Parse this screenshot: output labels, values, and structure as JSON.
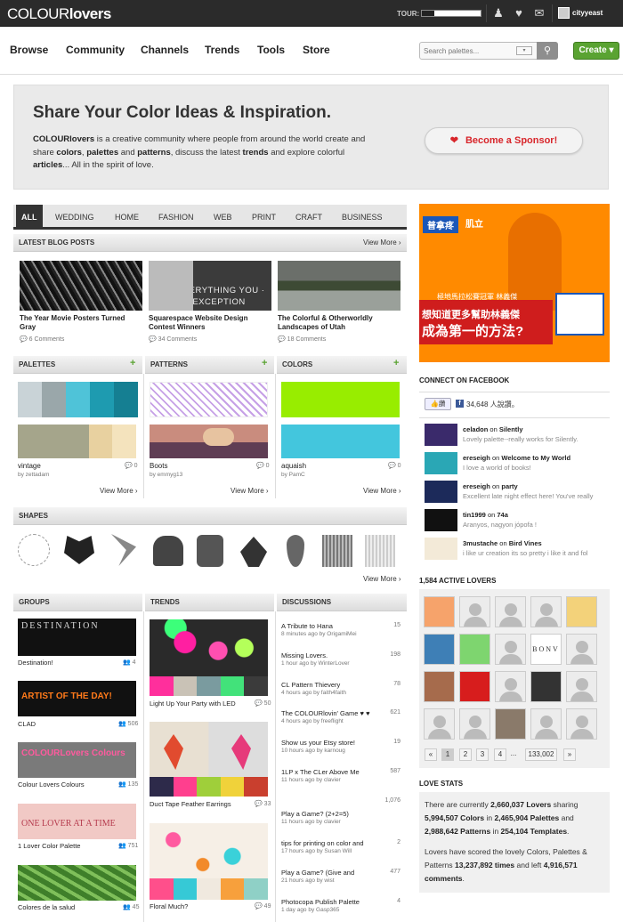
{
  "topbar": {
    "logo_light": "COLOUR",
    "logo_bold": "lovers",
    "tour_label": "TOUR:",
    "user_name": "cityyeast"
  },
  "nav": {
    "items": [
      "Browse",
      "Community",
      "Channels",
      "Trends",
      "Tools",
      "Store"
    ],
    "search_placeholder": "Search palettes...",
    "create_label": "Create ▾"
  },
  "hero": {
    "title": "Share Your Color Ideas & Inspiration.",
    "text_html_parts": [
      "COLOURlovers",
      " is a creative community where people from around the world create and share ",
      "colors",
      ", ",
      "palettes",
      " and ",
      "patterns",
      ", discuss the latest ",
      "trends",
      " and explore colorful ",
      "articles",
      "... All in the spirit of love."
    ],
    "sponsor": "Become a Sponsor!"
  },
  "tabs": [
    "ALL",
    "WEDDING",
    "HOME",
    "FASHION",
    "WEB",
    "PRINT",
    "CRAFT",
    "BUSINESS"
  ],
  "blog": {
    "heading": "LATEST BLOG POSTS",
    "view_more": "View More ›",
    "posts": [
      {
        "title": "The Year Movie Posters Turned Gray",
        "comments": "6 Comments"
      },
      {
        "title": "Squarespace Website Design Contest Winners",
        "comments": "34 Comments",
        "overlay": "EVERYTHING YOU · AN EXCEPTION"
      },
      {
        "title": "The Colorful & Otherworldly Landscapes of Utah",
        "comments": "18 Comments"
      }
    ]
  },
  "palettes": {
    "heading": "PALETTES",
    "view_more": "View More ›",
    "name": "vintage",
    "by": "by zettadam",
    "count": "0"
  },
  "patterns": {
    "heading": "PATTERNS",
    "view_more": "View More ›",
    "name": "Boots",
    "by": "by emmyg13",
    "count": "0"
  },
  "colors": {
    "heading": "COLORS",
    "view_more": "View More ›",
    "name": "aquaish",
    "by": "by PamC",
    "count": "0"
  },
  "shapes": {
    "heading": "SHAPES",
    "view_more": "View More ›"
  },
  "groups": {
    "heading": "GROUPS",
    "items": [
      {
        "name": "Destination!",
        "count": "4",
        "banner": "DESTINATION"
      },
      {
        "name": "CLAD",
        "count": "506",
        "banner": "ARTIST OF THE DAY!"
      },
      {
        "name": "Colour Lovers Colours",
        "count": "135",
        "banner": "COLOURLovers Colours"
      },
      {
        "name": "1 Lover Color Palette",
        "count": "751",
        "banner": "ONE LOVER AT A TIME"
      },
      {
        "name": "Colores de la salud",
        "count": "45"
      }
    ]
  },
  "trends": {
    "heading": "TRENDS",
    "items": [
      {
        "name": "Light Up Your Party with LED",
        "count": "50"
      },
      {
        "name": "Duct Tape Feather Earrings",
        "count": "33"
      },
      {
        "name": "Floral Much?",
        "count": "49"
      }
    ]
  },
  "discussions": {
    "heading": "DISCUSSIONS",
    "items": [
      {
        "title": "A Tribute to Hana",
        "meta": "8 minutes ago by OrigamiMei",
        "count": "15"
      },
      {
        "title": "Missing Lovers.",
        "meta": "1 hour ago by WinterLover",
        "count": "198"
      },
      {
        "title": "CL Pattern Thievery",
        "meta": "4 hours ago by faith4faith",
        "count": "78"
      },
      {
        "title": "The COLOURlovin' Game ♥ ♥",
        "meta": "4 hours ago by freeflight",
        "count": "621"
      },
      {
        "title": "Show us your Etsy store!",
        "meta": "10 hours ago by karnoug",
        "count": "19"
      },
      {
        "title": "1LP x The CLer Above Me",
        "meta": "11 hours ago by clavier",
        "count": "587"
      },
      {
        "title": "",
        "meta": "",
        "count": "1,076"
      },
      {
        "title": "Play a Game? (2+2=5)",
        "meta": "11 hours ago by clavier",
        "count": ""
      },
      {
        "title": "tips for printing on color and",
        "meta": "17 hours ago by Susan Will",
        "count": "2"
      },
      {
        "title": "Play a Game? (Give and",
        "meta": "21 hours ago by wist",
        "count": "477"
      },
      {
        "title": "Photocopa Publish Palette",
        "meta": "1 day ago by Gasp365",
        "count": "4"
      }
    ]
  },
  "ad": {
    "brand_left": "普拿疼",
    "brand_right": "肌立",
    "line1": "極地馬拉松賽冠軍 林義傑",
    "line2": "想知道更多幫助林義傑",
    "line3": "成為第一的方法?"
  },
  "facebook": {
    "heading": "CONNECT ON FACEBOOK",
    "like": "讚",
    "count_text": "34,648 人說讚。",
    "items": [
      {
        "user": "celadon",
        "on": " on ",
        "target": "Silently",
        "text": "Lovely palette--really works for Silently."
      },
      {
        "user": "ereseigh",
        "on": " on ",
        "target": "Welcome to My World",
        "text": "I love a world of books!"
      },
      {
        "user": "ereseigh",
        "on": " on ",
        "target": "party",
        "text": "Excellent late night effect here! You've really"
      },
      {
        "user": "tin1999",
        "on": " on ",
        "target": "74a",
        "text": "Aranyos, nagyon jópofa !"
      },
      {
        "user": "3mustache",
        "on": " on ",
        "target": "Bird Vines",
        "text": "i like ur creation its so pretty i like it and fol"
      }
    ]
  },
  "lovers": {
    "heading": "1,584 ACTIVE LOVERS",
    "pages": [
      "«",
      "1",
      "2",
      "3",
      "4",
      "...",
      "133,002",
      "»"
    ],
    "bonv": "BONV"
  },
  "stats": {
    "heading": "LOVE STATS",
    "p1a": "There are currently ",
    "p1b": "2,660,037 Lovers",
    "p1c": " sharing ",
    "p1d": "5,994,507 Colors",
    "p1e": " in ",
    "p1f": "2,465,904 Palettes",
    "p1g": " and ",
    "p1h": "2,988,642 Patterns",
    "p1i": " in ",
    "p1j": "254,104 Templates",
    "p1k": ".",
    "p2a": "Lovers have scored the lovely Colors, Palettes & Patterns ",
    "p2b": "13,237,892 times",
    "p2c": " and left ",
    "p2d": "4,916,571 comments",
    "p2e": "."
  },
  "colors_accent": {
    "green": "#5aa332",
    "red": "#d8262b",
    "dark": "#2b2b2b"
  }
}
